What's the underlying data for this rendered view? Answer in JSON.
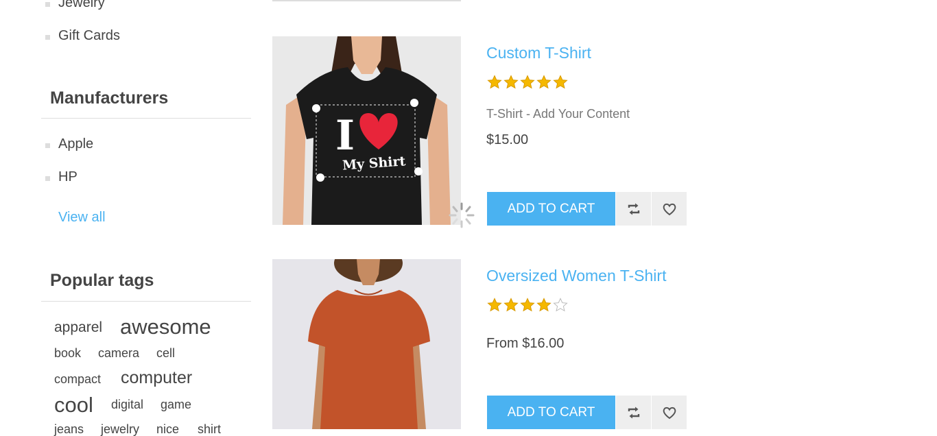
{
  "sidebar": {
    "categories": [
      {
        "label": "Jewelry"
      },
      {
        "label": "Gift Cards"
      }
    ],
    "manufacturers": {
      "title": "Manufacturers",
      "items": [
        {
          "label": "Apple"
        },
        {
          "label": "HP"
        }
      ],
      "view_all": "View all"
    },
    "popular_tags": {
      "title": "Popular tags",
      "tags": [
        {
          "label": "apparel"
        },
        {
          "label": "awesome"
        },
        {
          "label": "book"
        },
        {
          "label": "camera"
        },
        {
          "label": "cell"
        },
        {
          "label": "compact"
        },
        {
          "label": "computer"
        },
        {
          "label": "cool"
        },
        {
          "label": "digital"
        },
        {
          "label": "game"
        },
        {
          "label": "jeans"
        },
        {
          "label": "jewelry"
        },
        {
          "label": "nice"
        },
        {
          "label": "shirt"
        }
      ]
    }
  },
  "products": [
    {
      "title": "Custom T-Shirt",
      "rating": 5,
      "rating_max": 5,
      "description": "T-Shirt - Add Your Content",
      "price": "$15.00",
      "add_to_cart": "ADD TO CART",
      "image_text_line1": "I",
      "image_text_line2": "My Shirt"
    },
    {
      "title": "Oversized Women T-Shirt",
      "rating": 4,
      "rating_max": 5,
      "description": "",
      "price": "From $16.00",
      "add_to_cart": "ADD TO CART"
    }
  ],
  "colors": {
    "accent": "#4ab2f1",
    "star_filled": "#f5b800",
    "shirt_black": "#1b1b1b",
    "shirt_orange": "#c2532a",
    "heart_red": "#e8253a"
  }
}
